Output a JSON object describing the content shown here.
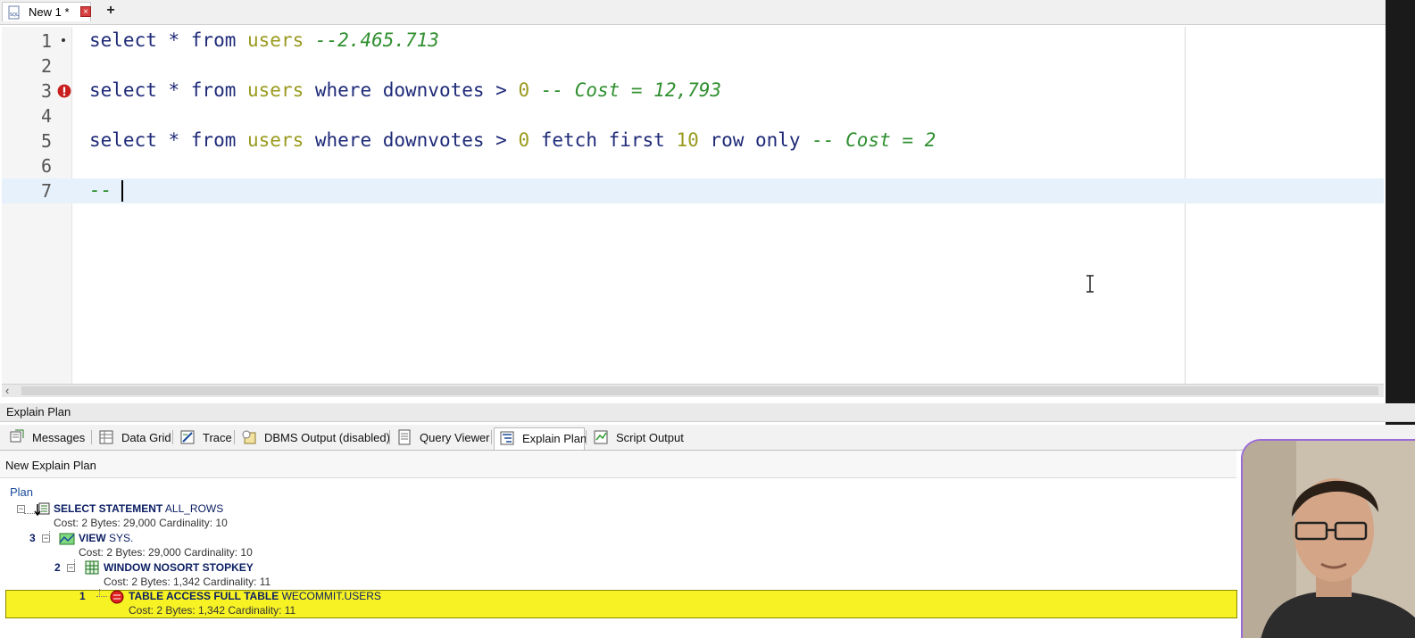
{
  "tabs": {
    "active_tab": "New 1 *",
    "close_glyph": "×",
    "add_glyph": "+"
  },
  "editor": {
    "lines": [
      {
        "num": "1",
        "tokens": [
          [
            "k",
            "select * from "
          ],
          [
            "t",
            "users"
          ],
          [
            "c",
            " --2.465.713"
          ]
        ]
      },
      {
        "num": "2",
        "tokens": []
      },
      {
        "num": "3",
        "tokens": [
          [
            "k",
            "select * from "
          ],
          [
            "t",
            "users"
          ],
          [
            "k",
            " where downvotes > "
          ],
          [
            "n",
            "0"
          ],
          [
            "c",
            " -- Cost = 12,793"
          ]
        ]
      },
      {
        "num": "4",
        "tokens": []
      },
      {
        "num": "5",
        "tokens": [
          [
            "k",
            "select * from "
          ],
          [
            "t",
            "users"
          ],
          [
            "k",
            " where downvotes > "
          ],
          [
            "n",
            "0"
          ],
          [
            "k",
            " fetch first "
          ],
          [
            "n",
            "10"
          ],
          [
            "k",
            " row only"
          ],
          [
            "c",
            " -- Cost = 2"
          ]
        ]
      },
      {
        "num": "6",
        "tokens": []
      },
      {
        "num": "7",
        "tokens": [
          [
            "c",
            "--"
          ]
        ]
      }
    ]
  },
  "panel": {
    "title": "Explain Plan",
    "output_tabs": [
      {
        "label": "Messages",
        "icon": "messages-icon"
      },
      {
        "label": "Data Grid",
        "icon": "data-grid-icon"
      },
      {
        "label": "Trace",
        "icon": "trace-icon"
      },
      {
        "label": "DBMS Output (disabled)",
        "icon": "dbms-output-icon"
      },
      {
        "label": "Query Viewer",
        "icon": "query-viewer-icon"
      },
      {
        "label": "Explain Plan",
        "icon": "explain-plan-icon",
        "active": true
      },
      {
        "label": "Script Output",
        "icon": "script-output-icon"
      }
    ],
    "subheader": "New Explain Plan",
    "plan_header": "Plan",
    "nodes": [
      {
        "id": "",
        "op": "SELECT STATEMENT",
        "obj": "ALL_ROWS",
        "stats": "Cost: 2  Bytes: 29,000  Cardinality: 10"
      },
      {
        "id": "3",
        "op": "VIEW",
        "obj": "SYS.",
        "stats": "Cost: 2  Bytes: 29,000  Cardinality: 10"
      },
      {
        "id": "2",
        "op": "WINDOW NOSORT STOPKEY",
        "obj": "",
        "stats": "Cost: 2  Bytes: 1,342  Cardinality: 11"
      },
      {
        "id": "1",
        "op": "TABLE ACCESS FULL TABLE",
        "obj": "WECOMMIT.USERS",
        "stats": "Cost: 2  Bytes: 1,342  Cardinality: 11"
      }
    ]
  },
  "colors": {
    "keyword": "#1e2a78",
    "table_name": "#9a9a1f",
    "comment": "#2f8f2f",
    "highlight_row": "#f7f224",
    "current_line": "#e7f1fb"
  }
}
